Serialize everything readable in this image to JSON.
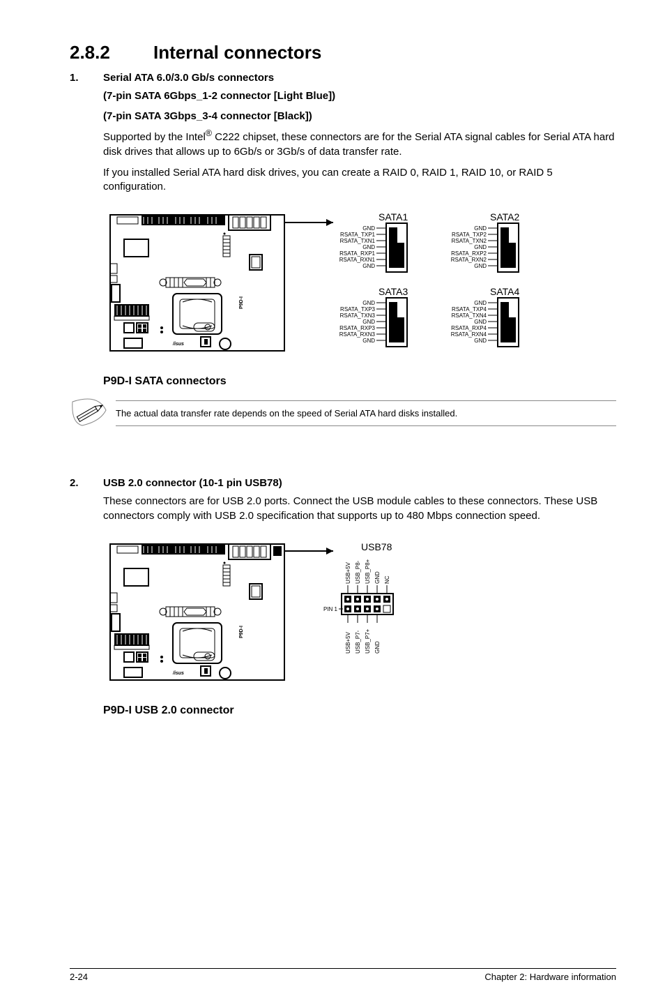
{
  "section": {
    "number": "2.8.2",
    "title": "Internal connectors"
  },
  "item1": {
    "num": "1.",
    "title": "Serial ATA 6.0/3.0 Gb/s connectors",
    "sub1": "(7-pin SATA 6Gbps_1-2 connector [Light Blue])",
    "sub2": "(7-pin SATA 3Gbps_3-4 connector [Black])",
    "para_a": "Supported by the Intel",
    "reg": "®",
    "para_b": " C222 chipset, these connectors are for the Serial ATA signal cables for Serial ATA hard disk drives that allows up to 6Gb/s or 3Gb/s of data transfer rate.",
    "para2": "If you installed Serial ATA hard disk drives, you can create a RAID 0, RAID 1, RAID 10, or RAID 5 configuration."
  },
  "diagram1": {
    "caption": "P9D-I SATA connectors",
    "board_label": "P9D-I",
    "brand": "/isus",
    "connectors": [
      {
        "name": "SATA1",
        "pins": [
          "GND",
          "RSATA_TXP1",
          "RSATA_TXN1",
          "GND",
          "RSATA_RXP1",
          "RSATA_RXN1",
          "GND"
        ]
      },
      {
        "name": "SATA2",
        "pins": [
          "GND",
          "RSATA_TXP2",
          "RSATA_TXN2",
          "GND",
          "RSATA_RXP2",
          "RSATA_RXN2",
          "GND"
        ]
      },
      {
        "name": "SATA3",
        "pins": [
          "GND",
          "RSATA_TXP3",
          "RSATA_TXN3",
          "GND",
          "RSATA_RXP3",
          "RSATA_RXN3",
          "GND"
        ]
      },
      {
        "name": "SATA4",
        "pins": [
          "GND",
          "RSATA_TXP4",
          "RSATA_TXN4",
          "GND",
          "RSATA_RXP4",
          "RSATA_RXN4",
          "GND"
        ]
      }
    ]
  },
  "note1": {
    "text": "The actual data transfer rate depends on the speed of Serial ATA hard disks installed."
  },
  "item2": {
    "num": "2.",
    "title": "USB 2.0 connector (10-1 pin USB78)",
    "para": "These connectors are for USB 2.0 ports. Connect the USB module cables to these connectors. These USB connectors comply with USB 2.0 specification that supports up to 480 Mbps connection speed."
  },
  "diagram2": {
    "caption": "P9D-I USB 2.0 connector",
    "board_label": "P9D-I",
    "brand": "/isus",
    "header": "USB78",
    "pin1": "PIN 1",
    "pins_top": [
      "USB+5V",
      "USB_P8-",
      "USB_P8+",
      "GND",
      "NC"
    ],
    "pins_bottom": [
      "USB+5V",
      "USB_P7-",
      "USB_P7+",
      "GND"
    ]
  },
  "footer": {
    "page": "2-24",
    "chapter": "Chapter 2: Hardware information"
  }
}
